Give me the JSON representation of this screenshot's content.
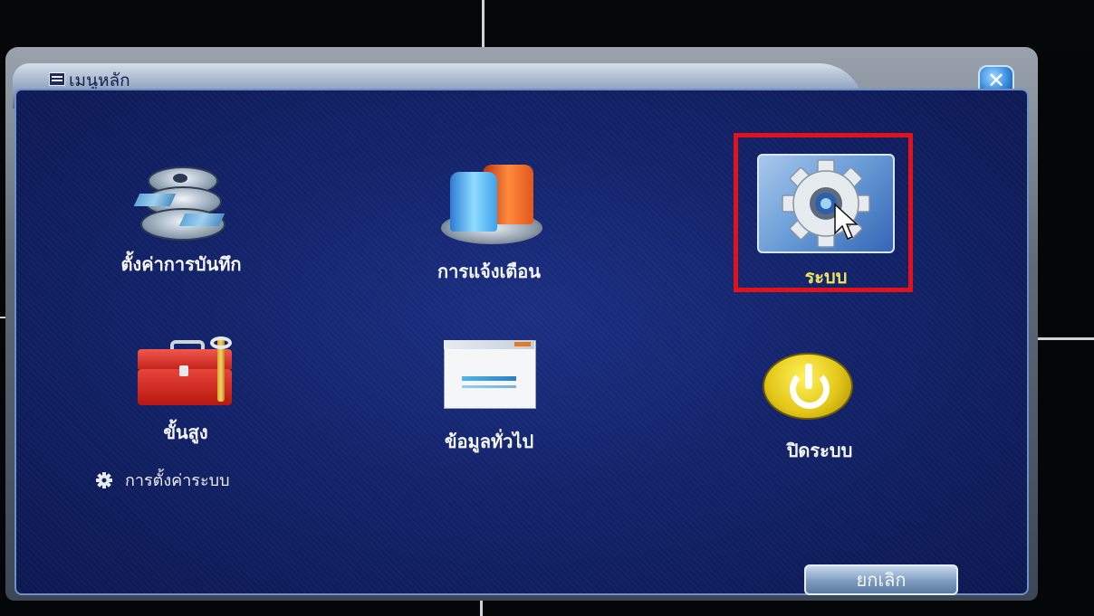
{
  "window": {
    "title": "เมนูหลัก",
    "close_icon": "close-icon"
  },
  "menu": {
    "items": [
      {
        "label": "ตั้งค่าการบันทึก",
        "icon": "film-reel-icon"
      },
      {
        "label": "การแจ้งเตือน",
        "icon": "alarm-siren-icon"
      },
      {
        "label": "ระบบ",
        "icon": "gear-icon",
        "selected": true
      },
      {
        "label": "ขั้นสูง",
        "icon": "toolbox-icon"
      },
      {
        "label": "ข้อมูลทั่วไป",
        "icon": "info-window-icon"
      },
      {
        "label": "ปิดระบบ",
        "icon": "power-icon"
      }
    ]
  },
  "status": {
    "label": "การตั้งค่าระบบ",
    "icon": "small-gear-icon"
  },
  "footer": {
    "cancel_label": "ยกเลิก"
  },
  "colors": {
    "panel_blue": "#13236a",
    "highlight_red": "#e0121b",
    "selected_label": "#f3e35a"
  }
}
